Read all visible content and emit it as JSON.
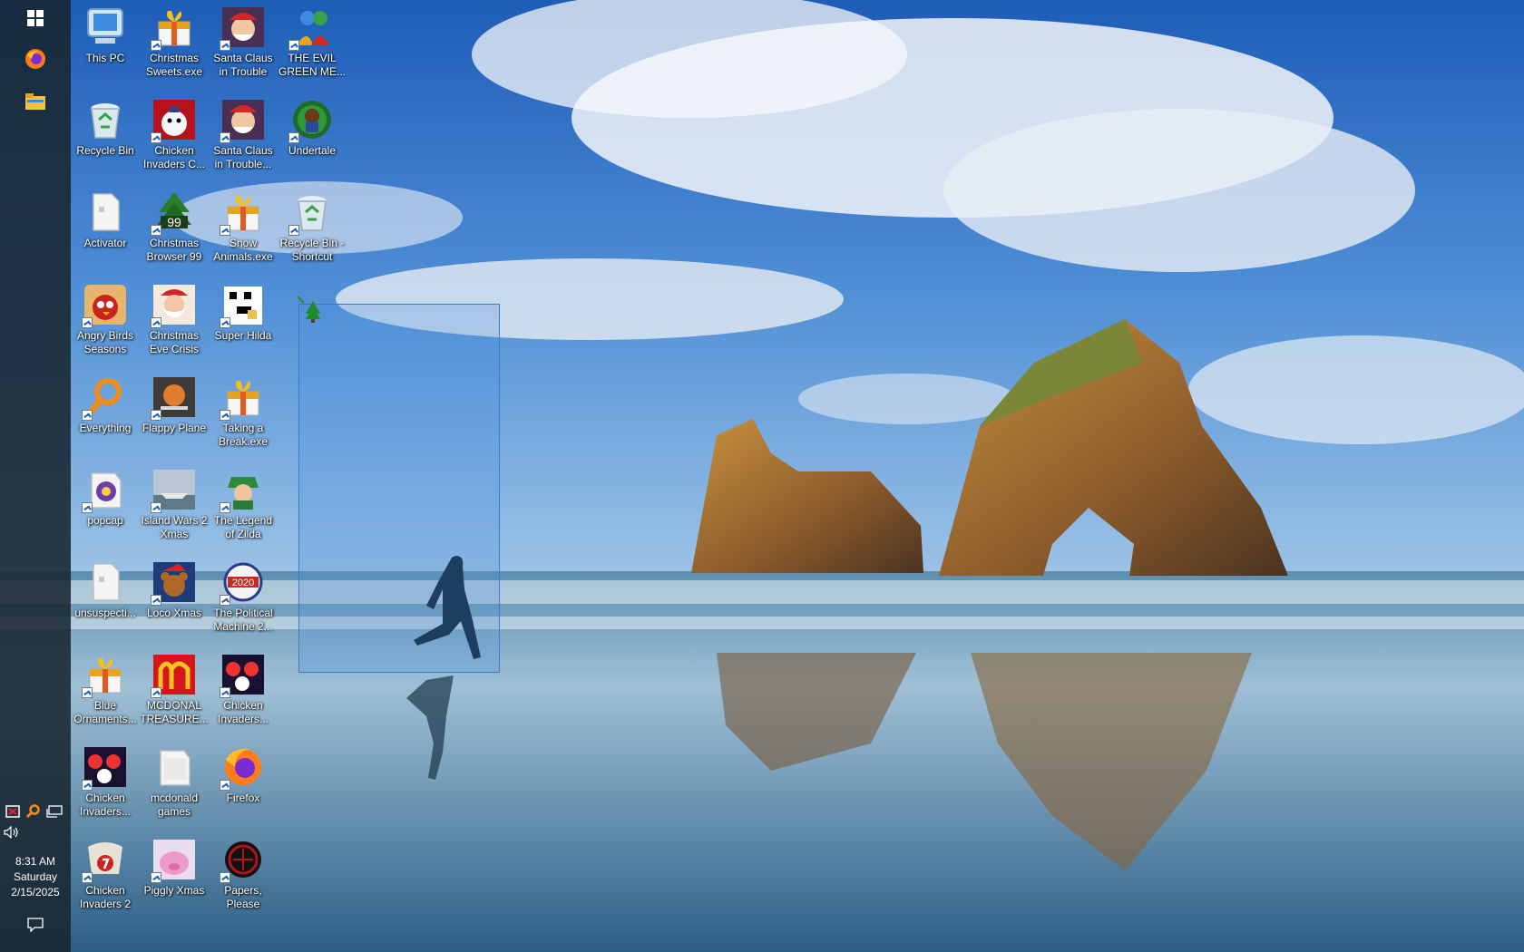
{
  "taskbar": {
    "start_icon": "windows-logo-icon",
    "pinned": [
      {
        "name": "firefox",
        "icon": "firefox-icon"
      },
      {
        "name": "file-explorer",
        "icon": "folder-icon"
      }
    ],
    "tray_icons": [
      "security-icon",
      "search-magnifier-icon",
      "network-icon",
      "volume-icon"
    ],
    "clock": {
      "time": "8:31 AM",
      "day": "Saturday",
      "date": "2/15/2025"
    },
    "notification_icon": "action-center-icon"
  },
  "desktop": {
    "icons": [
      {
        "label": "This PC",
        "icon": "computer-icon",
        "shortcut": false
      },
      {
        "label": "Recycle Bin",
        "icon": "recycle-bin-icon",
        "shortcut": false
      },
      {
        "label": "Activator",
        "icon": "file-icon",
        "shortcut": false
      },
      {
        "label": "Angry Birds\nSeasons",
        "icon": "angry-birds-icon",
        "shortcut": true
      },
      {
        "label": "Everything",
        "icon": "magnifier-icon",
        "shortcut": true
      },
      {
        "label": "popcap",
        "icon": "popcap-icon",
        "shortcut": true
      },
      {
        "label": "unsuspecti...",
        "icon": "file-icon",
        "shortcut": false
      },
      {
        "label": "Blue\nOrnaments...",
        "icon": "gift-icon",
        "shortcut": true
      },
      {
        "label": "Chicken\nInvaders...",
        "icon": "chicken-invaders-icon",
        "shortcut": true
      },
      {
        "label": "Chicken\nInvaders 2",
        "icon": "chicken-2-icon",
        "shortcut": true
      },
      {
        "label": "Christmas\nSweets.exe",
        "icon": "gift-icon",
        "shortcut": true
      },
      {
        "label": "Chicken\nInvaders C...",
        "icon": "chicken-snowman-icon",
        "shortcut": true
      },
      {
        "label": "Christmas\nBrowser 99",
        "icon": "christmas-tree-icon",
        "shortcut": true
      },
      {
        "label": "Christmas\nEve Crisis",
        "icon": "santa-icon",
        "shortcut": true
      },
      {
        "label": "Flappy Plane",
        "icon": "plane-icon",
        "shortcut": true
      },
      {
        "label": "Island Wars 2\nXmas",
        "icon": "island-wars-icon",
        "shortcut": true
      },
      {
        "label": "Loco Xmas",
        "icon": "teddy-bear-icon",
        "shortcut": true
      },
      {
        "label": "MCDONAL\nTREASURE...",
        "icon": "mcdonalds-icon",
        "shortcut": true
      },
      {
        "label": "mcdonald\ngames",
        "icon": "folder-icon",
        "shortcut": false
      },
      {
        "label": "Piggly Xmas",
        "icon": "pig-icon",
        "shortcut": true
      },
      {
        "label": "Santa Claus\nin Trouble",
        "icon": "santa-game-icon",
        "shortcut": true
      },
      {
        "label": "Santa Claus\nin Trouble...",
        "icon": "santa-game-icon",
        "shortcut": true
      },
      {
        "label": "Snow\nAnimals.exe",
        "icon": "gift-icon",
        "shortcut": true
      },
      {
        "label": "Super Hilda",
        "icon": "pixel-art-icon",
        "shortcut": true
      },
      {
        "label": "Taking a\nBreak.exe",
        "icon": "gift-icon",
        "shortcut": true
      },
      {
        "label": "The Legend\nof Zilda",
        "icon": "zelda-icon",
        "shortcut": true
      },
      {
        "label": "The Political\nMachine 2...",
        "icon": "political-machine-icon",
        "shortcut": true
      },
      {
        "label": "Chicken\nInvaders...",
        "icon": "chicken-invaders-icon",
        "shortcut": true
      },
      {
        "label": "Firefox",
        "icon": "firefox-icon",
        "shortcut": true
      },
      {
        "label": "Papers,\nPlease",
        "icon": "papers-please-icon",
        "shortcut": true
      },
      {
        "label": "THE EVIL\nGREEN ME...",
        "icon": "evil-green-icon",
        "shortcut": true
      },
      {
        "label": "Undertale",
        "icon": "undertale-icon",
        "shortcut": true
      },
      {
        "label": "Recycle Bin -\nShortcut",
        "icon": "recycle-bin-icon",
        "shortcut": true
      }
    ]
  },
  "colors": {
    "taskbar_bg": "#182630",
    "selection_border": "#2b7cd3",
    "sky": "#2a6fc4",
    "sea": "#3d6f8c"
  }
}
